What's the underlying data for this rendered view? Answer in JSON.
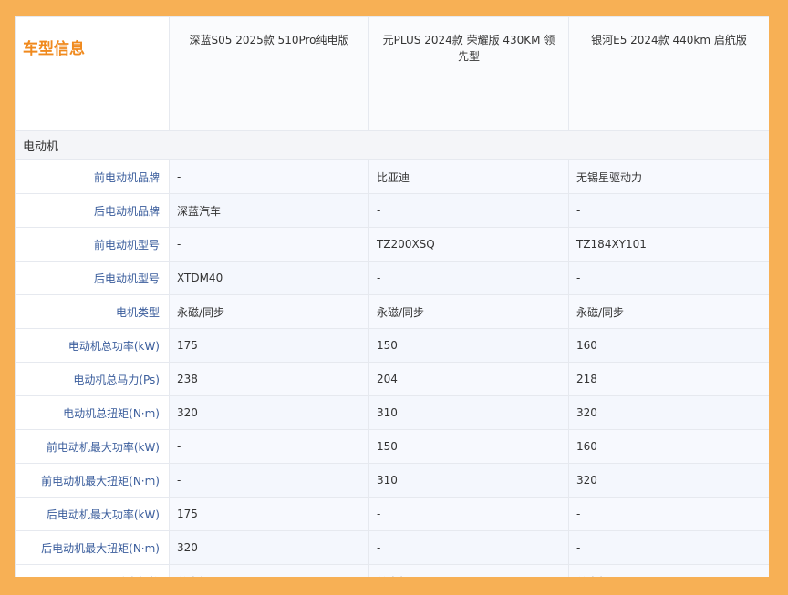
{
  "header": {
    "brand_title": "车型信息",
    "cars": [
      "深蓝S05 2025款 510Pro纯电版",
      "元PLUS 2024款 荣耀版 430KM 领先型",
      "银河E5 2024款 440km 启航版"
    ]
  },
  "section": {
    "title": "电动机"
  },
  "rows": [
    {
      "label": "前电动机品牌",
      "values": [
        "-",
        "比亚迪",
        "无锡星驱动力"
      ]
    },
    {
      "label": "后电动机品牌",
      "values": [
        "深蓝汽车",
        "-",
        "-"
      ]
    },
    {
      "label": "前电动机型号",
      "values": [
        "-",
        "TZ200XSQ",
        "TZ184XY101"
      ]
    },
    {
      "label": "后电动机型号",
      "values": [
        "XTDM40",
        "-",
        "-"
      ]
    },
    {
      "label": "电机类型",
      "values": [
        "永磁/同步",
        "永磁/同步",
        "永磁/同步"
      ]
    },
    {
      "label": "电动机总功率(kW)",
      "values": [
        "175",
        "150",
        "160"
      ]
    },
    {
      "label": "电动机总马力(Ps)",
      "values": [
        "238",
        "204",
        "218"
      ]
    },
    {
      "label": "电动机总扭矩(N·m)",
      "values": [
        "320",
        "310",
        "320"
      ]
    },
    {
      "label": "前电动机最大功率(kW)",
      "values": [
        "-",
        "150",
        "160"
      ]
    },
    {
      "label": "前电动机最大扭矩(N·m)",
      "values": [
        "-",
        "310",
        "320"
      ]
    },
    {
      "label": "后电动机最大功率(kW)",
      "values": [
        "175",
        "-",
        "-"
      ]
    },
    {
      "label": "后电动机最大扭矩(N·m)",
      "values": [
        "320",
        "-",
        "-"
      ]
    },
    {
      "label": "驱动电机数",
      "values": [
        "单电机",
        "单电机",
        "单电机"
      ]
    }
  ],
  "colors": {
    "background": "#F7B055",
    "brand_title": "#F08A1E",
    "label_text": "#3a5d9c"
  }
}
